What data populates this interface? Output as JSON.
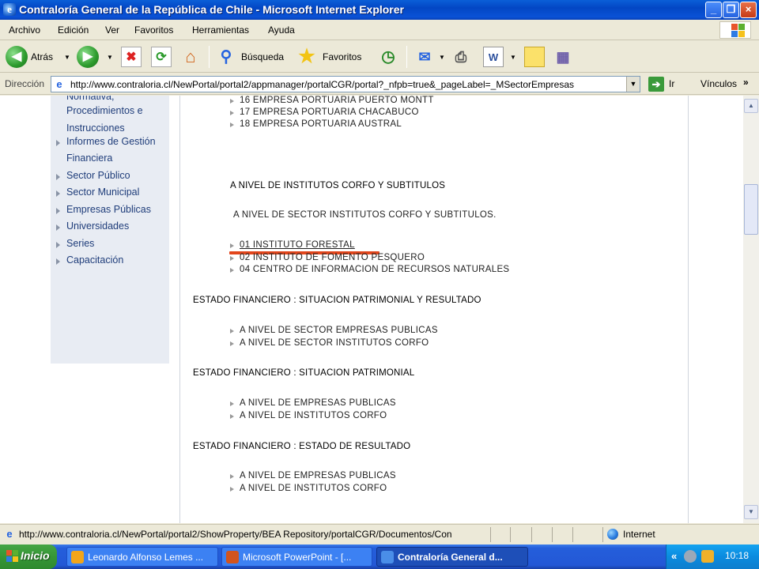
{
  "window": {
    "title": "Contraloría General de la República de Chile - Microsoft Internet Explorer",
    "minimize": "_",
    "maximize": "❐",
    "close": "×"
  },
  "menu": [
    "Archivo",
    "Edición",
    "Ver",
    "Favoritos",
    "Herramientas",
    "Ayuda"
  ],
  "toolbar": {
    "back_label": "Atrás",
    "search_label": "Búsqueda",
    "favorites_label": "Favoritos"
  },
  "address": {
    "label": "Dirección",
    "url": "http://www.contraloria.cl/NewPortal/portal2/appmanager/portalCGR/portal?_nfpb=true&_pageLabel=_MSectorEmpresas",
    "go_label": "Ir",
    "links_label": "Vínculos"
  },
  "sidebar": {
    "items": [
      {
        "label": "Normativa,",
        "bullet": false
      },
      {
        "label": "Procedimientos e",
        "bullet": false
      },
      {
        "label": "Instrucciones",
        "bullet": false
      },
      {
        "label": "Informes de Gestión",
        "bullet": true
      },
      {
        "label": "Financiera",
        "bullet": false
      },
      {
        "label": "Sector Público",
        "bullet": true
      },
      {
        "label": "Sector Municipal",
        "bullet": true
      },
      {
        "label": "Empresas Públicas",
        "bullet": true
      },
      {
        "label": "Universidades",
        "bullet": true
      },
      {
        "label": "Series",
        "bullet": true
      },
      {
        "label": "Capacitación",
        "bullet": true
      }
    ]
  },
  "content": {
    "ports": [
      "16 EMPRESA PORTUARIA PUERTO MONTT",
      "17 EMPRESA PORTUARIA CHACABUCO",
      "18 EMPRESA PORTUARIA AUSTRAL"
    ],
    "institutos_heading": "A NIVEL DE INSTITUTOS CORFO Y SUBTITULOS",
    "institutos_subheading": "A NIVEL DE SECTOR INSTITUTOS CORFO Y SUBTITULOS.",
    "institutos": [
      "01 INSTITUTO FORESTAL",
      "02 INSTITUTO DE FOMENTO PESQUERO",
      "04 CENTRO DE INFORMACION DE RECURSOS NATURALES"
    ],
    "section1": {
      "heading": "ESTADO FINANCIERO : SITUACION PATRIMONIAL Y RESULTADO",
      "links": [
        "A NIVEL DE SECTOR EMPRESAS PUBLICAS",
        "A NIVEL DE SECTOR INSTITUTOS CORFO"
      ]
    },
    "section2": {
      "heading": "ESTADO FINANCIERO : SITUACION PATRIMONIAL",
      "links": [
        "A NIVEL DE EMPRESAS PUBLICAS",
        "A NIVEL DE INSTITUTOS CORFO"
      ]
    },
    "section3": {
      "heading": "ESTADO FINANCIERO : ESTADO DE RESULTADO",
      "links": [
        "A NIVEL DE EMPRESAS PUBLICAS",
        "A NIVEL DE INSTITUTOS CORFO"
      ]
    }
  },
  "status": {
    "text": "http://www.contraloria.cl/NewPortal/portal2/ShowProperty/BEA Repository/portalCGR/Documentos/Con",
    "zone": "Internet"
  },
  "taskbar": {
    "start_label": "Inicio",
    "tasks": [
      "Leonardo Alfonso Lemes ...",
      "Microsoft PowerPoint - [...",
      "Contraloría General d..."
    ],
    "tray_chevron": "«",
    "clock": "10:18"
  },
  "colors": {
    "accent_underline": "#e2461c",
    "sidebar_bg": "#e8ecf3",
    "titlebar": "#0346c4"
  }
}
